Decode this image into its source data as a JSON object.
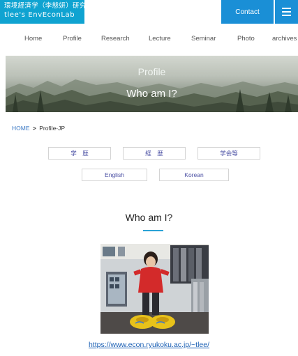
{
  "header": {
    "logo_line1": "環境経済学（李態妍）研究室",
    "logo_line2": "tlee's EnvEconLab",
    "contact_label": "Contact"
  },
  "nav": {
    "items": [
      {
        "label": "Home"
      },
      {
        "label": "Profile"
      },
      {
        "label": "Research"
      },
      {
        "label": "Lecture"
      },
      {
        "label": "Seminar"
      },
      {
        "label": "Photo"
      },
      {
        "label": "archives"
      }
    ]
  },
  "hero": {
    "subtitle": "Profile",
    "title": "Who am I?"
  },
  "breadcrumb": {
    "home": "HOME",
    "separator": ">",
    "current": "Profile-JP"
  },
  "tabs": {
    "row1": [
      {
        "label": "学　歴"
      },
      {
        "label": "経　歴"
      },
      {
        "label": "学会等"
      }
    ],
    "row2": [
      {
        "label": "English"
      },
      {
        "label": "Korean"
      }
    ]
  },
  "section": {
    "title": "Who am I?"
  },
  "link": {
    "url_text": "https://www.econ.ryukoku.ac.jp/~tlee/"
  },
  "colors": {
    "brand": "#0fa3d1",
    "contact": "#1a8fd6",
    "accent_underline": "#2aa3d6",
    "tab_text": "#4a4fa3"
  }
}
